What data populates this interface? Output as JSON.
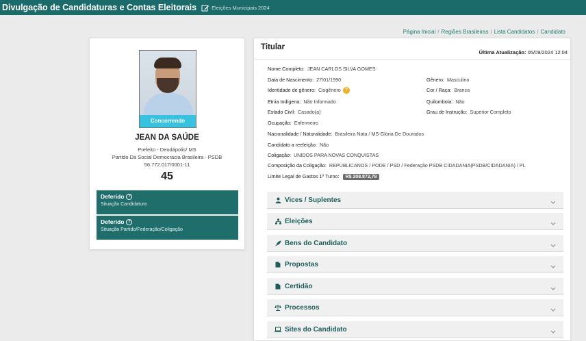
{
  "header": {
    "app_title": "Divulgação de Candidaturas e Contas Eleitorais",
    "election_label": "Eleições Municipais 2024",
    "bg_color": "#1c6b6b"
  },
  "breadcrumb": {
    "items": [
      "Página Inicial",
      "Regiões Brasileiras",
      "Lista Candidatos",
      "Candidato"
    ]
  },
  "candidate": {
    "photo_status": "Concorrendo",
    "display_name": "JEAN DA SAÚDE",
    "office": "Prefeito - Deodápolis/ MS",
    "party": "Partido Da Social Democracia Brasileira - PSDB",
    "cnpj": "56.772.017/0001-11",
    "number": "45"
  },
  "status_boxes": [
    {
      "title": "Deferido",
      "subtitle": "Situação Candidatura"
    },
    {
      "title": "Deferido",
      "subtitle": "Situação Partido/Federação/Coligação"
    }
  ],
  "details": {
    "title": "Titular",
    "updated_label": "Última Atualização:",
    "updated_value": "05/09/2024 12:04",
    "full_name_label": "Nome Completo:",
    "full_name": "JEAN CARLOS SILVA GOMES",
    "birth_label": "Data de Nascimento:",
    "birth": "27/01/1990",
    "gender_label": "Gênero:",
    "gender": "Masculino",
    "identity_label": "Identidade de gênero:",
    "identity": "Cisgênero",
    "color_label": "Cor / Raça:",
    "color": "Branca",
    "ethnicity_label": "Etnia Indígena:",
    "ethnicity": "Não Informado",
    "quilombola_label": "Quilombola:",
    "quilombola": "Não",
    "civil_label": "Estado Civil:",
    "civil": "Casado(a)",
    "education_label": "Grau de Instrução:",
    "education": "Superior Completo",
    "occupation_label": "Ocupação:",
    "occupation": "Enfermeiro",
    "nationality_label": "Nacionalidade / Naturalidade:",
    "nationality": "Brasileira Nata / MS-Glória De Dourados",
    "reelection_label": "Candidato a reeleição:",
    "reelection": "Não",
    "coalition_label": "Coligação:",
    "coalition": "UNIDOS PARA NOVAS CONQUISTAS",
    "composition_label": "Composição da Coligação:",
    "composition": "REPUBLICANOS / PODE / PSD / Federação PSDB CIDADANIA(PSDB/CIDADANIA) / PL",
    "limit_label": "Limite Legal de Gastos 1º Turno:",
    "limit": "R$ 208.872,78"
  },
  "accordions": [
    {
      "label": "Vices / Suplentes",
      "icon": "person-icon"
    },
    {
      "label": "Eleições",
      "icon": "sitemap-icon"
    },
    {
      "label": "Bens do Candidato",
      "icon": "rocket-icon"
    },
    {
      "label": "Propostas",
      "icon": "file-icon"
    },
    {
      "label": "Certidão",
      "icon": "file-icon"
    },
    {
      "label": "Processos",
      "icon": "scale-icon"
    },
    {
      "label": "Sites do Candidato",
      "icon": "laptop-icon"
    }
  ]
}
